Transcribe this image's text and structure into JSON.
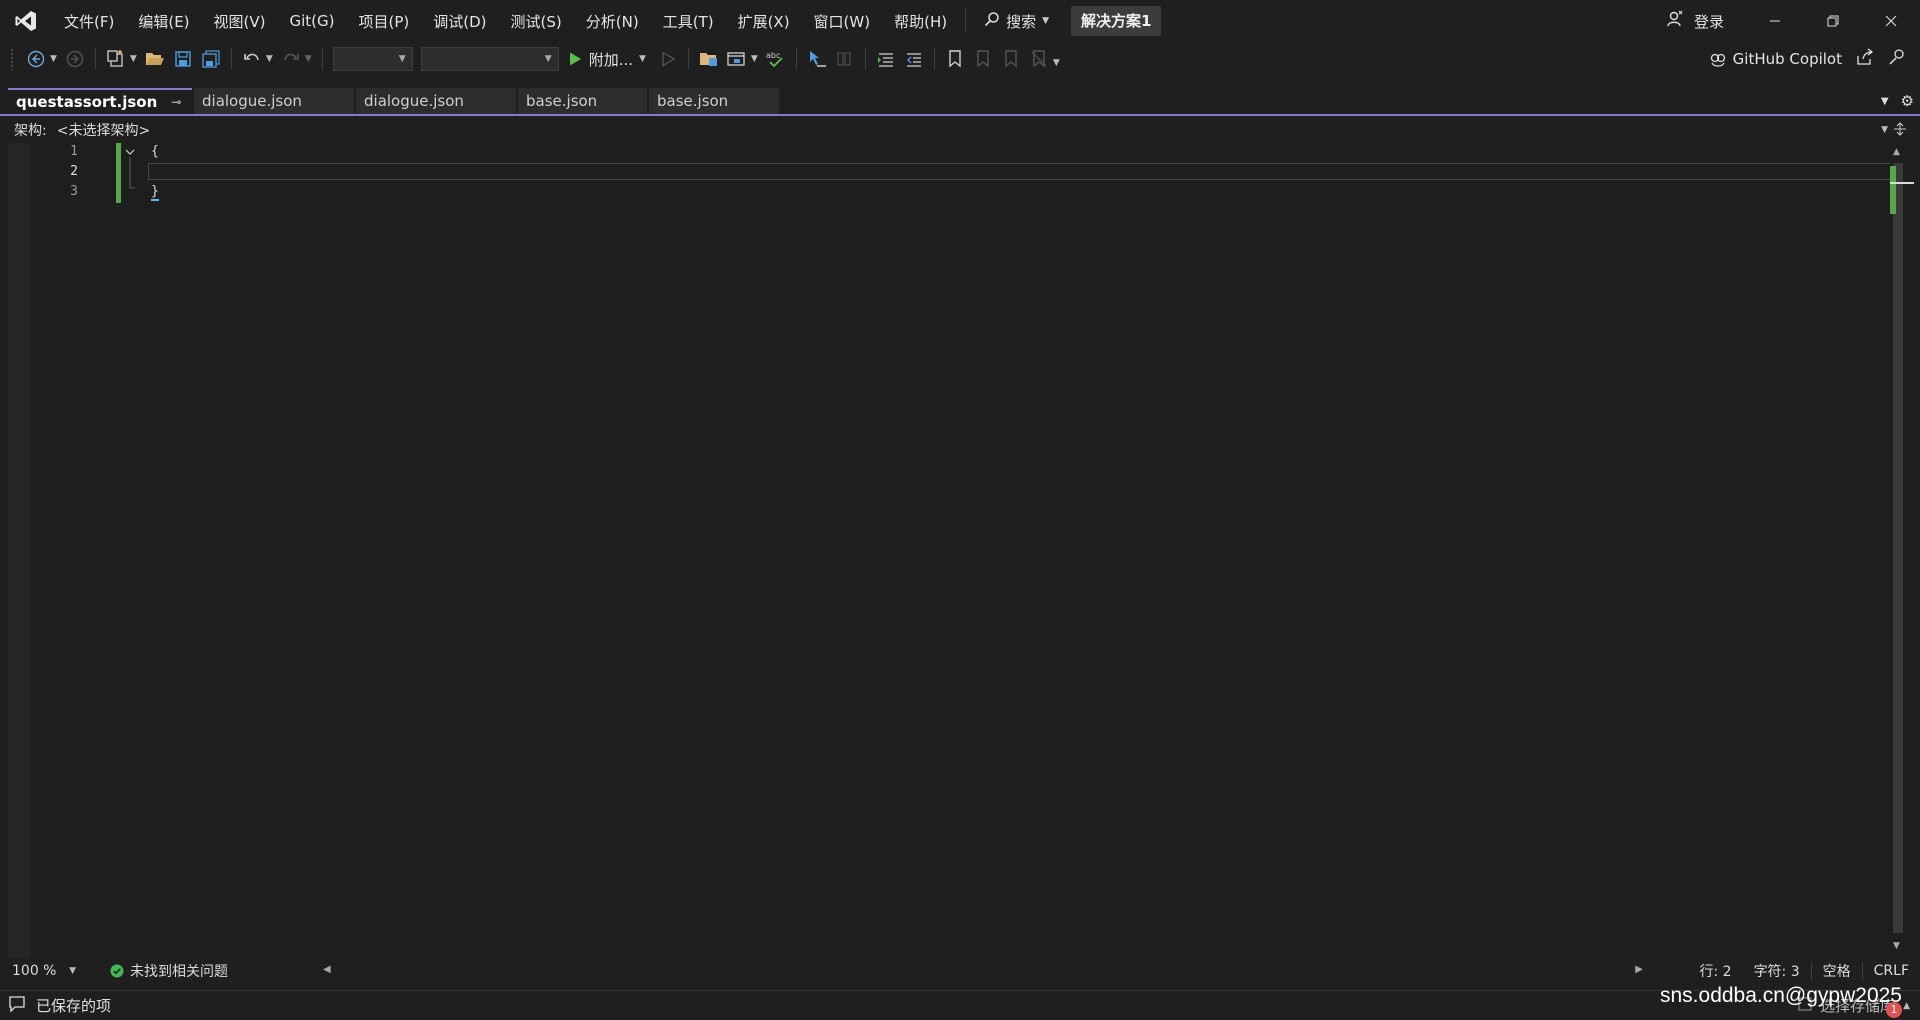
{
  "menu": {
    "items": [
      "文件(F)",
      "编辑(E)",
      "视图(V)",
      "Git(G)",
      "项目(P)",
      "调试(D)",
      "测试(S)",
      "分析(N)",
      "工具(T)",
      "扩展(X)",
      "窗口(W)",
      "帮助(H)"
    ],
    "search_label": "搜索",
    "solution_name": "解决方案1",
    "sign_in": "登录"
  },
  "toolbar": {
    "attach_label": "附加...",
    "copilot_label": "GitHub Copilot"
  },
  "tabs": [
    {
      "label": "questassort.json",
      "active": true
    },
    {
      "label": "dialogue.json",
      "active": false
    },
    {
      "label": "dialogue.json",
      "active": false
    },
    {
      "label": "base.json",
      "active": false
    },
    {
      "label": "base.json",
      "active": false
    }
  ],
  "navbar": {
    "label": "架构:",
    "value": "<未选择架构>"
  },
  "editor": {
    "line_numbers": [
      "1",
      "2",
      "3"
    ],
    "lines": [
      "{",
      "",
      "}"
    ]
  },
  "editor_status": {
    "zoom": "100 %",
    "issues": "未找到相关问题",
    "line": "行: 2",
    "char": "字符: 3",
    "indent": "空格",
    "eol": "CRLF"
  },
  "statusbar": {
    "saved": "已保存的项",
    "select_repo": "选择存储库",
    "notification_count": "1",
    "watermark": "sns.oddba.cn@gypw2025"
  },
  "colors": {
    "accent": "#8a77d1",
    "change_bar": "#57a64a",
    "background": "#1f1f1f",
    "editor_bg": "#1e1e1e"
  }
}
